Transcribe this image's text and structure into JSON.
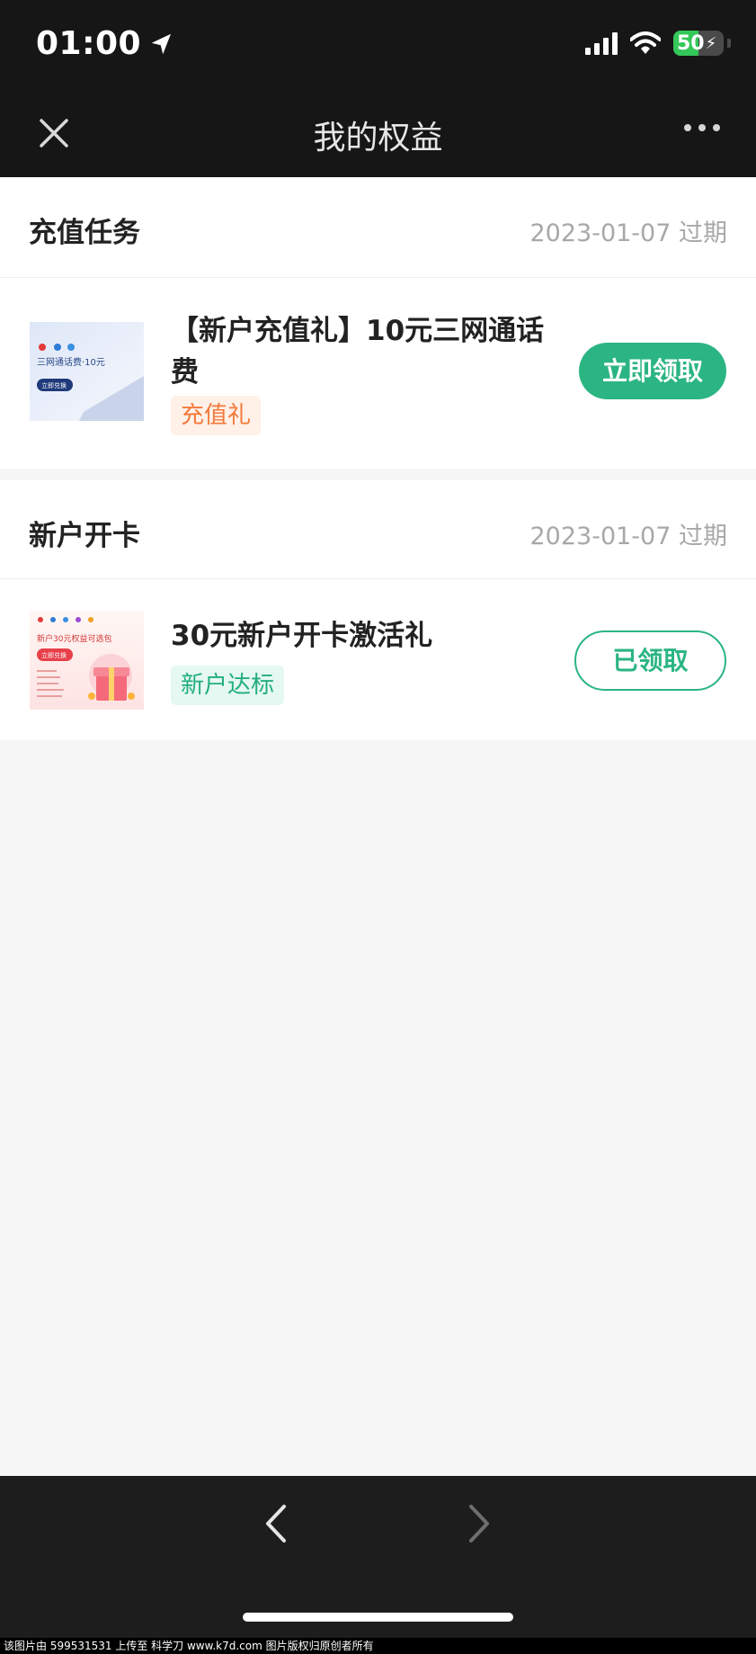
{
  "status_bar": {
    "time": "01:00",
    "battery": "50"
  },
  "nav": {
    "title": "我的权益"
  },
  "sections": [
    {
      "title": "充值任务",
      "expiry": "2023-01-07 过期",
      "item": {
        "title": "【新户充值礼】10元三网通话费",
        "tag": "充值礼",
        "button": "立即领取",
        "thumb": {
          "text": "三网通话费·10元",
          "button": "立即兑换"
        }
      }
    },
    {
      "title": "新户开卡",
      "expiry": "2023-01-07 过期",
      "item": {
        "title": "30元新户开卡激活礼",
        "tag": "新户达标",
        "button": "已领取",
        "thumb": {
          "text": "新户30元权益可选包",
          "button": "立即兑换"
        }
      }
    }
  ],
  "watermark": "该图片由 599531531 上传至 科学刀 www.k7d.com 图片版权归原创者所有",
  "colors": {
    "accent": "#2bb582",
    "tag_orange": "#f37a3a",
    "bar": "#161616"
  }
}
